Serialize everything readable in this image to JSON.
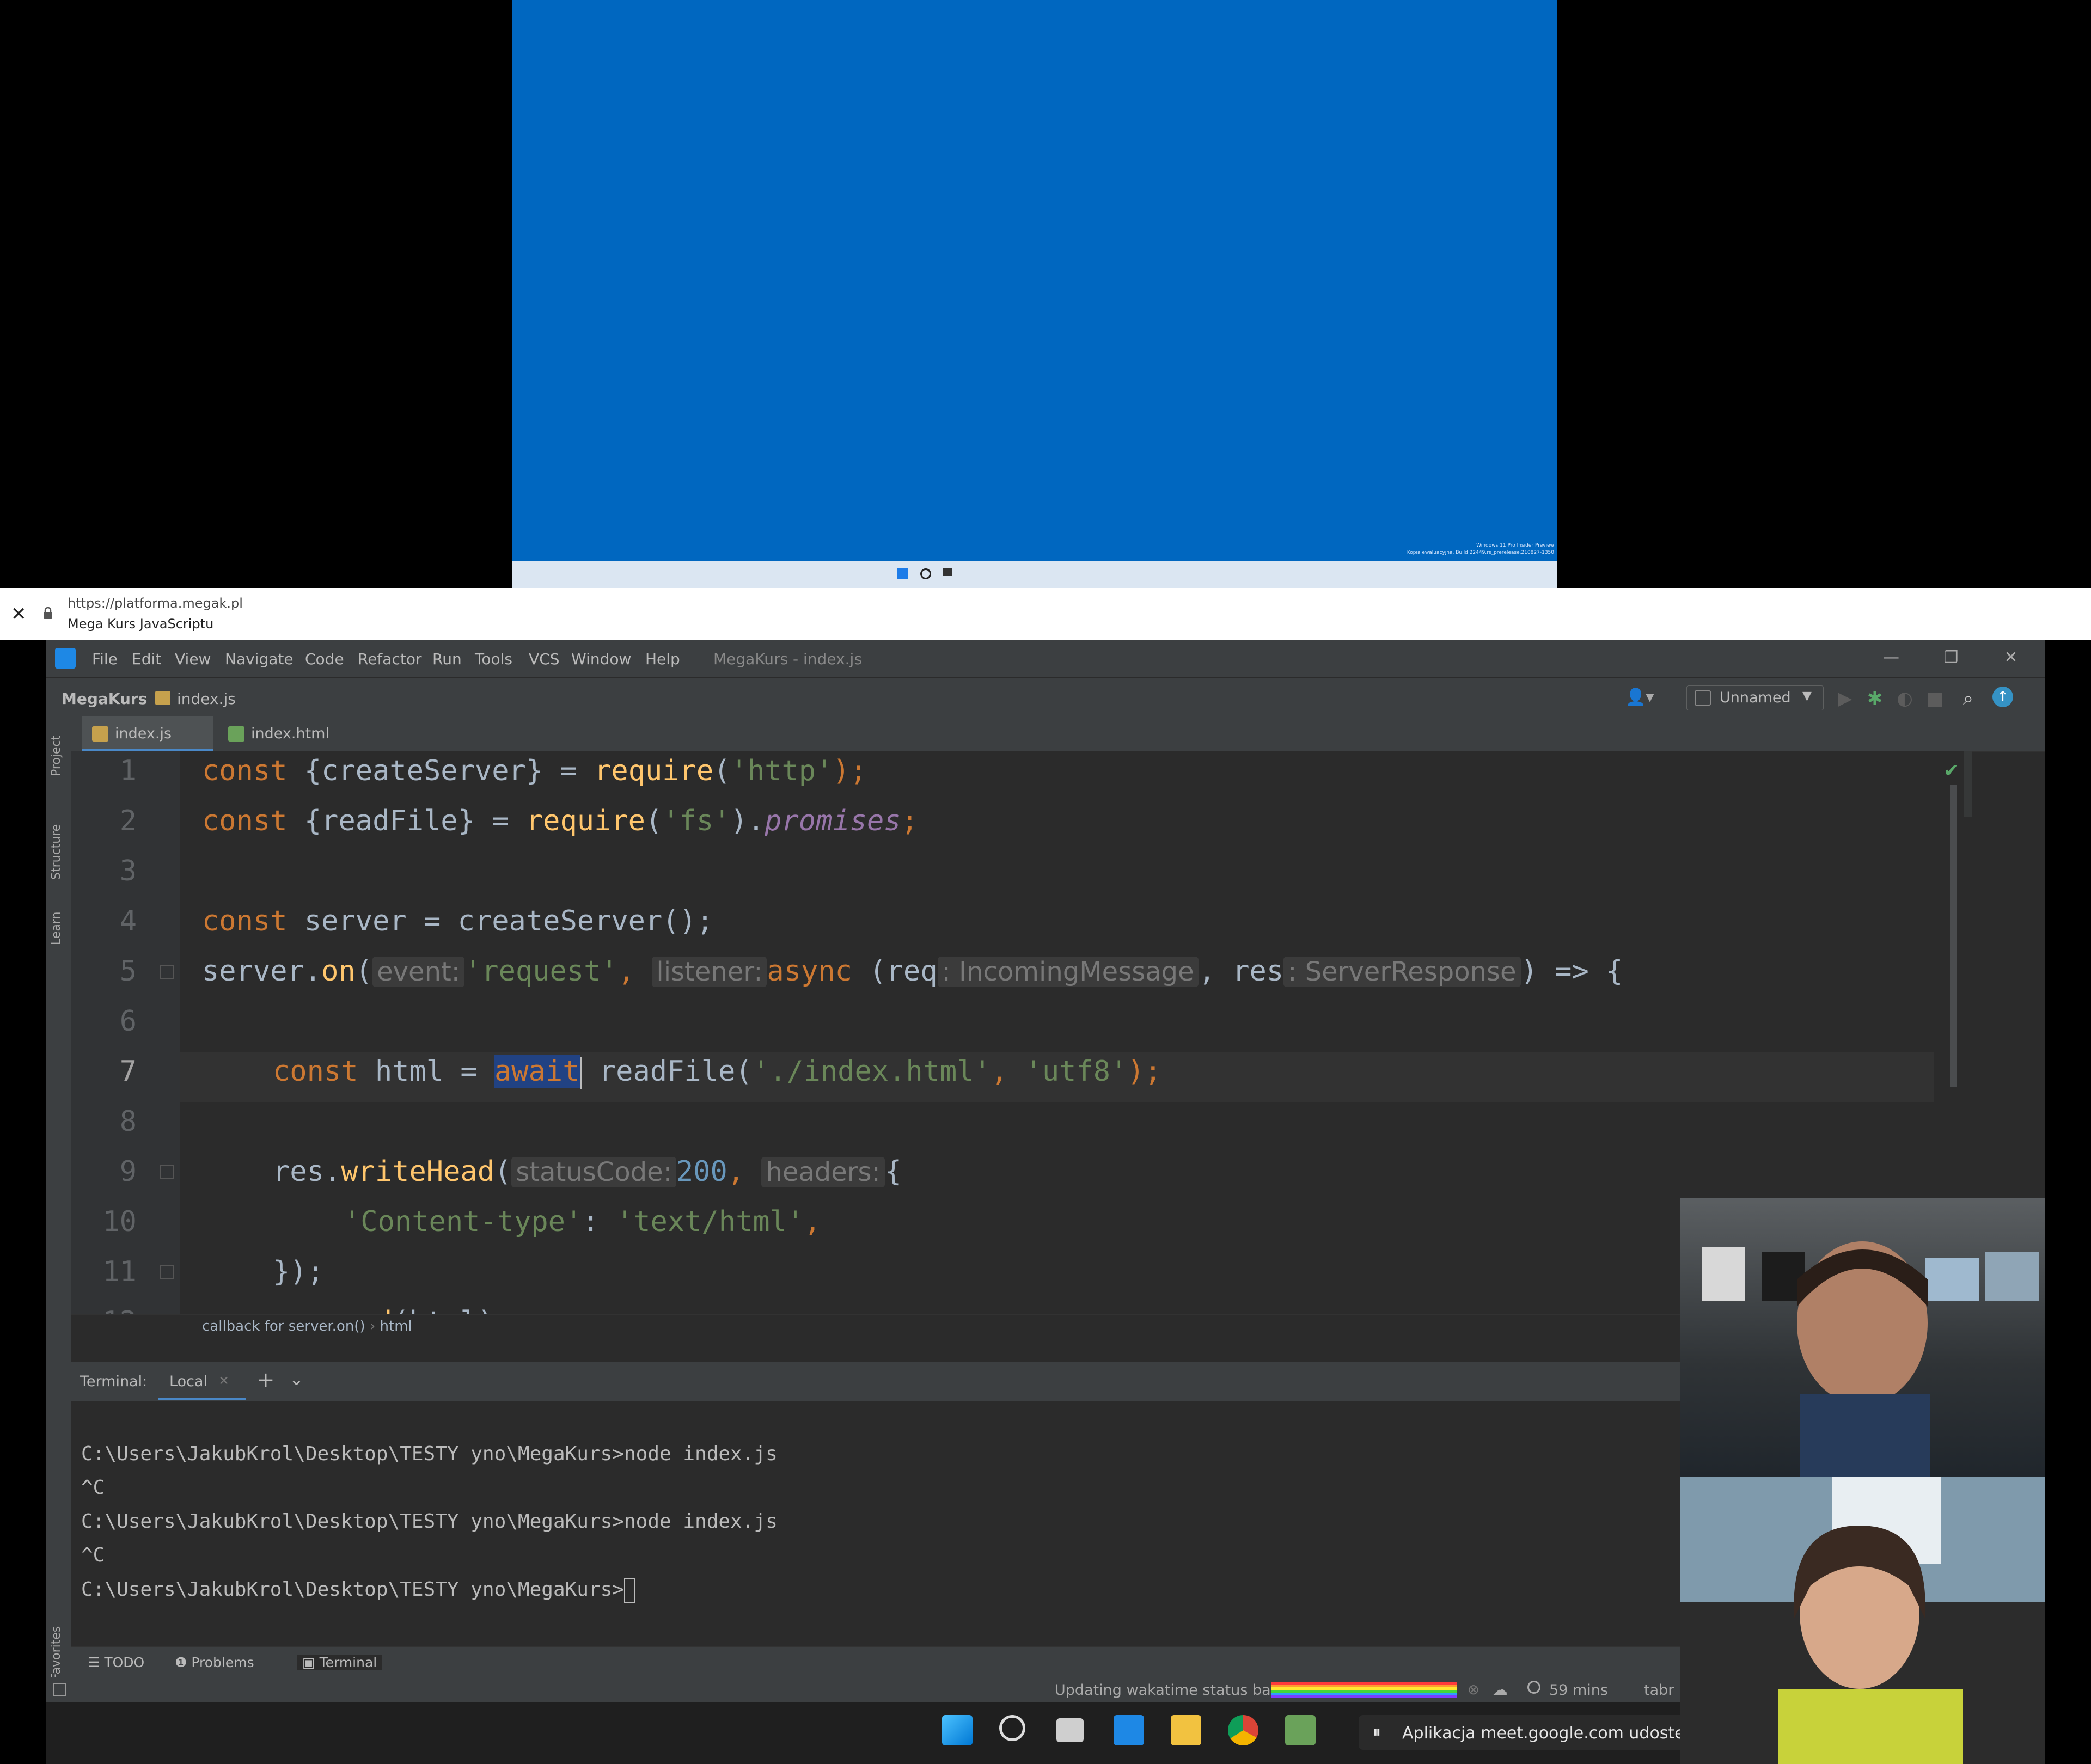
{
  "vm": {
    "watermark_line1": "Windows 11 Pro Insider Preview",
    "watermark_line2": "Kopia ewaluacyjna. Build 22449.rs_prerelease.210827-1350"
  },
  "browser": {
    "close_icon": "close-icon",
    "url": "https://platforma.megak.pl",
    "site_title": "Mega Kurs JavaScriptu"
  },
  "ide": {
    "menu": [
      "File",
      "Edit",
      "View",
      "Navigate",
      "Code",
      "Refactor",
      "Run",
      "Tools",
      "VCS",
      "Window",
      "Help"
    ],
    "window_title": "MegaKurs - index.js",
    "breadcrumb": {
      "project": "MegaKurs",
      "file": "index.js"
    },
    "run_config": "Unnamed",
    "left_strip": [
      "Project",
      "Structure",
      "Learn",
      "Favorites"
    ],
    "tabs": [
      {
        "label": "index.js",
        "active": true
      },
      {
        "label": "index.html",
        "active": false
      }
    ],
    "line_numbers": [
      "1",
      "2",
      "3",
      "4",
      "5",
      "6",
      "7",
      "8",
      "9",
      "10",
      "11",
      "12"
    ],
    "code": {
      "l1": {
        "kw": "const",
        "a": " {createServer} = ",
        "fn": "require",
        "b": "(",
        "str": "'http'",
        "c": ");"
      },
      "l2": {
        "kw": "const",
        "a": " {readFile} = ",
        "fn": "require",
        "b": "(",
        "str": "'fs'",
        "c": ").",
        "prop": "promises",
        "d": ";"
      },
      "l4": {
        "kw": "const",
        "a": " server = createServer();"
      },
      "l5": {
        "a": "server.",
        "fn": "on",
        "b": "(",
        "hint1": "event:",
        "str": "'request'",
        "c": ", ",
        "hint2": "listener:",
        "kw": "async",
        "d": " (req",
        "hint3": ": IncomingMessage",
        "e": ", res",
        "hint4": ": ServerResponse",
        "f": ") => {"
      },
      "l7": {
        "kw": "const",
        "a": " html = ",
        "sel": "await",
        "b": " readFile(",
        "str1": "'./index.html'",
        "c": ", ",
        "str2": "'utf8'",
        "d": ");"
      },
      "l9": {
        "a": "res.",
        "fn": "writeHead",
        "b": "(",
        "hint1": "statusCode:",
        "num": "200",
        "c": ", ",
        "hint2": "headers:",
        "d": "{"
      },
      "l10": {
        "str1": "'Content-type'",
        "a": ": ",
        "str2": "'text/html'",
        "b": ","
      },
      "l11": {
        "a": "});"
      },
      "l12": {
        "a": "res.",
        "fn": "end",
        "b": "(html);"
      }
    },
    "crumb": {
      "first": "callback for server.on()",
      "sep": "›",
      "second": "html"
    },
    "terminal": {
      "label": "Terminal:",
      "tab": "Local",
      "lines": [
        "C:\\Users\\JakubKrol\\Desktop\\TESTY yno\\MegaKurs>node index.js",
        "^C",
        "C:\\Users\\JakubKrol\\Desktop\\TESTY yno\\MegaKurs>node index.js",
        "^C",
        "C:\\Users\\JakubKrol\\Desktop\\TESTY yno\\MegaKurs>"
      ]
    },
    "tool_tabs": [
      "TODO",
      "Problems",
      "Terminal"
    ],
    "status": {
      "message": "Updating wakatime status bar",
      "wakatime": "59 mins",
      "tabnine": "tabr"
    }
  },
  "taskbar": {
    "share_banner": "Aplikacja meet.google.com udostępnia Twc"
  }
}
